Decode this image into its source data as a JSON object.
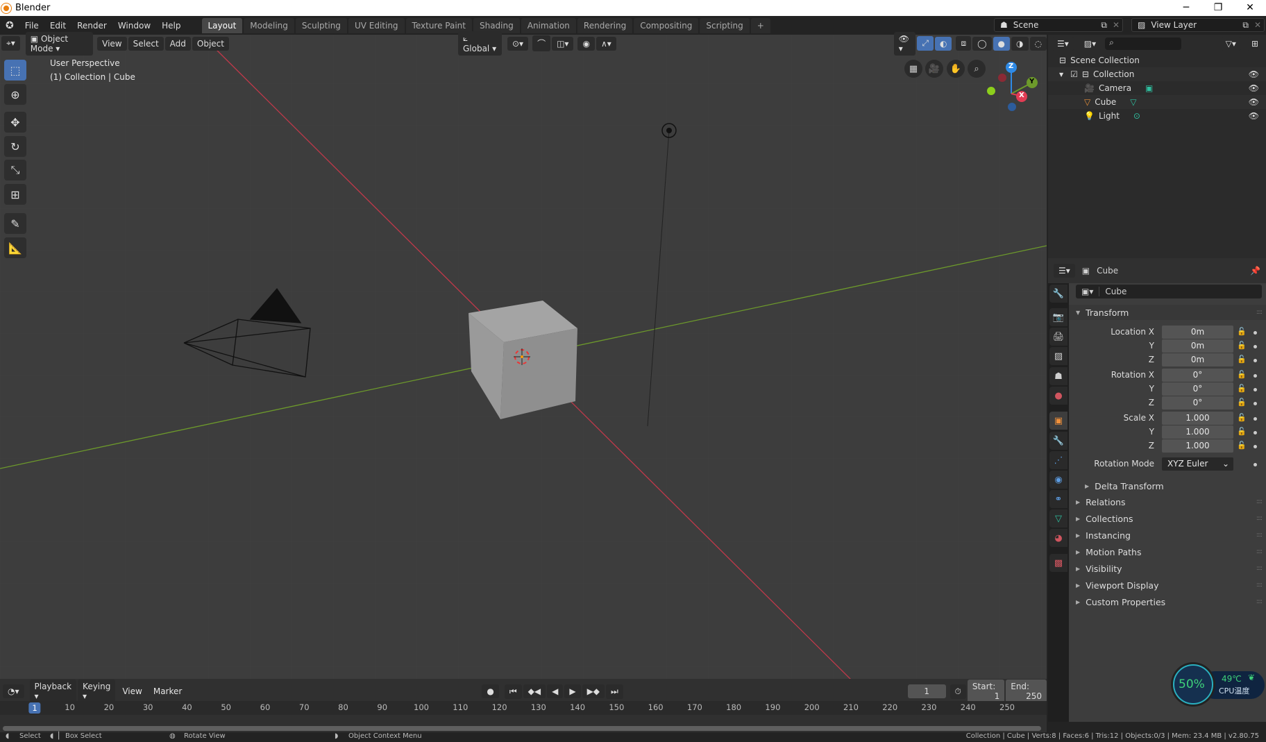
{
  "window": {
    "title": "Blender",
    "controls": [
      "─",
      "❐",
      "✕"
    ]
  },
  "topbar": {
    "menus": [
      "File",
      "Edit",
      "Render",
      "Window",
      "Help"
    ],
    "tabs": [
      "Layout",
      "Modeling",
      "Sculpting",
      "UV Editing",
      "Texture Paint",
      "Shading",
      "Animation",
      "Rendering",
      "Compositing",
      "Scripting",
      "+"
    ],
    "active_tab": "Layout",
    "scene": "Scene",
    "view_layer": "View Layer"
  },
  "viewport": {
    "mode": "Object Mode",
    "menus": [
      "View",
      "Select",
      "Add",
      "Object"
    ],
    "orientation": "Global",
    "overlay_title": "User Perspective",
    "overlay_sub": "(1) Collection | Cube",
    "gizmo": {
      "x": "X",
      "y": "Y",
      "z": "Z"
    },
    "colors": {
      "x_axis": "#c0394a",
      "y_axis": "#6d9a2b",
      "background": "#3d3d3d",
      "active": "#4772b3"
    }
  },
  "toolbar": [
    "select-box",
    "cursor",
    "move",
    "rotate",
    "scale",
    "transform",
    "annotate",
    "measure"
  ],
  "outliner": {
    "root": "Scene Collection",
    "collection": "Collection",
    "items": [
      {
        "name": "Camera",
        "icon": "camera-icon"
      },
      {
        "name": "Cube",
        "icon": "mesh-icon"
      },
      {
        "name": "Light",
        "icon": "light-icon"
      }
    ]
  },
  "properties": {
    "header": "Cube",
    "object_name": "Cube",
    "transform_title": "Transform",
    "rows": [
      {
        "label": "Location X",
        "value": "0m"
      },
      {
        "label": "Y",
        "value": "0m"
      },
      {
        "label": "Z",
        "value": "0m"
      },
      {
        "label": "Rotation X",
        "value": "0°"
      },
      {
        "label": "Y",
        "value": "0°"
      },
      {
        "label": "Z",
        "value": "0°"
      },
      {
        "label": "Scale X",
        "value": "1.000"
      },
      {
        "label": "Y",
        "value": "1.000"
      },
      {
        "label": "Z",
        "value": "1.000"
      }
    ],
    "rotation_mode_label": "Rotation Mode",
    "rotation_mode": "XYZ Euler",
    "delta": "Delta Transform",
    "panels": [
      "Relations",
      "Collections",
      "Instancing",
      "Motion Paths",
      "Visibility",
      "Viewport Display",
      "Custom Properties"
    ]
  },
  "timeline": {
    "menus": [
      "Playback",
      "Keying",
      "View",
      "Marker"
    ],
    "current_frame": "1",
    "start_label": "Start:",
    "start": "1",
    "end_label": "End:",
    "end": "250",
    "ticks": [
      1,
      10,
      20,
      30,
      40,
      50,
      60,
      70,
      80,
      90,
      100,
      110,
      120,
      130,
      140,
      150,
      160,
      170,
      180,
      190,
      200,
      210,
      220,
      230,
      240,
      250
    ]
  },
  "status": {
    "hints": [
      "Select",
      "Box Select",
      "Rotate View",
      "Object Context Menu"
    ],
    "info": "Collection | Cube | Verts:8 | Faces:6 | Tris:12 | Objects:0/3 | Mem: 23.4 MB | v2.80.75"
  },
  "cpu_widget": {
    "load": "50%",
    "temp": "49℃",
    "label": "CPU温度"
  }
}
